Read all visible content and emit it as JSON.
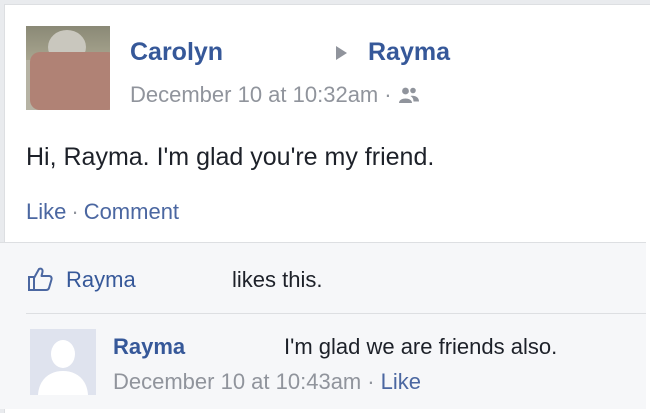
{
  "post": {
    "author_name": "Carolyn",
    "target_name": "Rayma",
    "timestamp": "December 10 at 10:32am",
    "separator": "·",
    "text": "Hi, Rayma. I'm glad you're my friend.",
    "actions": {
      "like": "Like",
      "comment": "Comment",
      "dot": "·"
    }
  },
  "likes": {
    "liker": "Rayma",
    "suffix": "likes this."
  },
  "comment": {
    "author_name": "Rayma",
    "text": "I'm glad we are friends also.",
    "timestamp": "December 10 at 10:43am",
    "separator": "·",
    "like_label": "Like"
  },
  "colors": {
    "link": "#365899",
    "meta": "#90949c",
    "text": "#1d2129",
    "redaction": "#b08275"
  },
  "icons": {
    "arrow": "right-triangle-icon",
    "audience": "friends-icon",
    "like": "thumbs-up-icon",
    "default_avatar": "silhouette-icon"
  }
}
